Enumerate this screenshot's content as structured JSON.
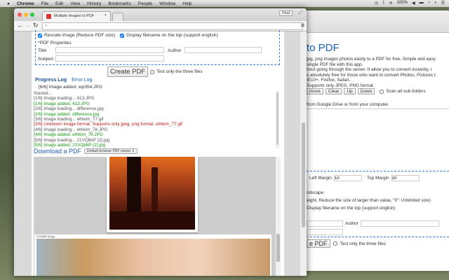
{
  "menubar": {
    "apple": "",
    "items": [
      "Chrome",
      "File",
      "Edit",
      "View",
      "History",
      "Bookmarks",
      "People",
      "Window",
      "Help"
    ],
    "battery": "100%"
  },
  "browser": {
    "tab_title": "Multiple Images to PDF",
    "profile": "First",
    "url": ""
  },
  "form": {
    "rescale_label": "Rescale image (Reduce PDF size)",
    "display_filename_label": "Display filename on the top (support english)",
    "rescale_checked": true,
    "display_checked": true,
    "pdf_properties": "*PDF Properties",
    "title_label": "Title",
    "author_label": "Author",
    "subject_label": "Subject",
    "create_button": "Create PDF",
    "test_only_label": "Test only the three files"
  },
  "log": {
    "progress_tab": "Progress Log",
    "error_tab": "Error Log",
    "status": "[6/6] Image added. wp354.JPG",
    "lines": [
      {
        "t": "Started...",
        "c": "k"
      },
      {
        "t": "[1/6] Image loading... 413.JPG",
        "c": "k"
      },
      {
        "t": "[1/6] Image added. 413.JPG",
        "c": "g"
      },
      {
        "t": "[2/6] Image loading... difference.jpg",
        "c": "k"
      },
      {
        "t": "[2/6] Image added. difference.jpg",
        "c": "g"
      },
      {
        "t": "[3/6] Image loading... ethkim_77.gif",
        "c": "k"
      },
      {
        "t": "[3/6] Unknown image format. Supports only jpeg, png format. ethkim_77.gif",
        "c": "r"
      },
      {
        "t": "[4/6] Image loading... ethkim_78.JPG",
        "c": "k"
      },
      {
        "t": "[4/6] Image added. ethkim_78.JPG",
        "c": "g"
      },
      {
        "t": "[5/6] Image loading... 21VQbkP (2).jpg",
        "c": "k"
      },
      {
        "t": "[5/6] Image added. 21VQbkP (2).jpg",
        "c": "g"
      }
    ]
  },
  "download": {
    "label": "Download a PDF",
    "viewer_select": "Default browser PDF viewer"
  },
  "preview": {
    "caption2": "21VQbkP (2).jpg"
  },
  "bg": {
    "title": "to PDF",
    "desc": [
      "jpg, png images photos easily to a PDF for free. Simple and easy",
      "single PDF file with this app.",
      "hout going through the server. It allow you to convert instantly, r",
      "s absolutely free for those who want to convert Photos, Pictures t",
      "IE10+, Firefox, Safari..",
      "Supports only JPEG, PNG format."
    ],
    "buttons": [
      "move",
      "Clear",
      "Up",
      "Down"
    ],
    "scan_label": "Scan all sub-folders",
    "source_text": "from Google Drive or from your computer.",
    "left_margin_label": "Left Margin",
    "left_margin": "10",
    "top_margin_label": "Top Margin",
    "top_margin": "10",
    "landscape": "ndscape",
    "resize_text": "eight, Reduce the size of larger than value, \"0\": Unlimited size)",
    "display_text": "Display filename on the top (support english)",
    "author_label": "Author",
    "create": "e PDF",
    "test_only": "Test only the three files"
  }
}
